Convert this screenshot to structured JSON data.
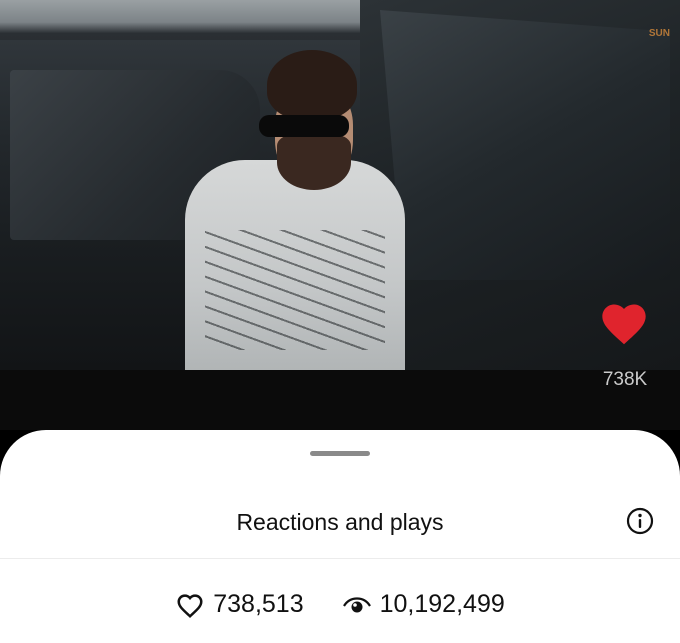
{
  "video": {
    "watermark": "SUN",
    "like_count": "738K"
  },
  "sheet": {
    "title": "Reactions and plays",
    "likes": "738,513",
    "plays": "10,192,499"
  },
  "icons": {
    "like": "heart-icon",
    "info": "info-icon",
    "stat_like": "heart-outline-icon",
    "stat_plays": "eye-icon"
  },
  "colors": {
    "heart": "#e0242d",
    "sheet_bg": "#ffffff",
    "text": "#111111"
  }
}
